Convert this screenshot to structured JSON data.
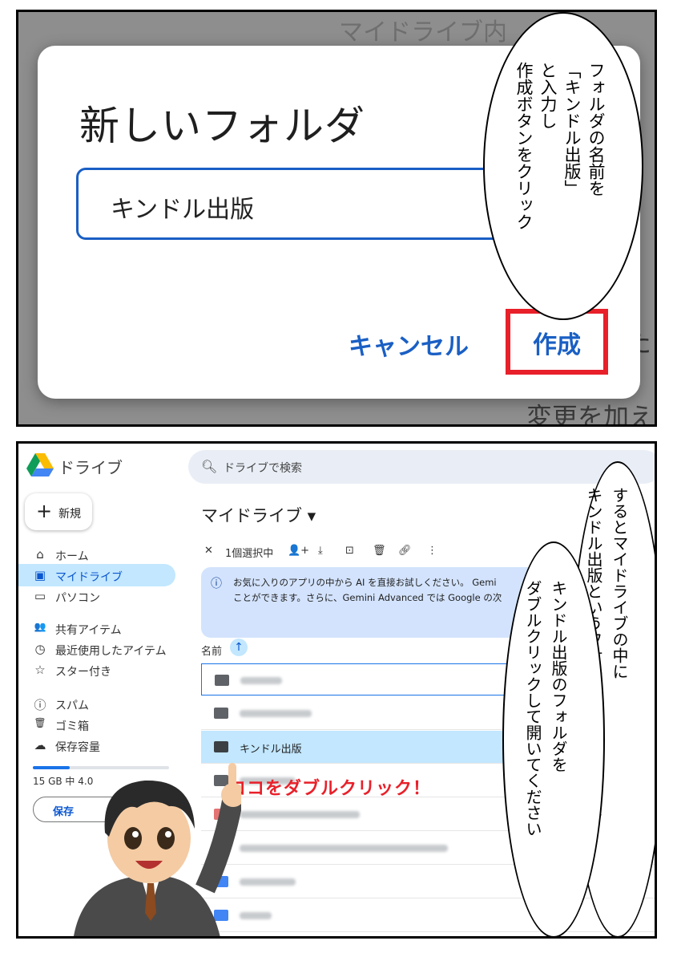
{
  "panel1": {
    "bg_text_top": "マイドライブ内",
    "bg_text_right": "た",
    "bg_text_bottom": "変更を加え",
    "dialog": {
      "title": "新しいフォルダ",
      "input_value": "キンドル出版",
      "cancel_label": "キャンセル",
      "create_label": "作成"
    },
    "bubble_lines": [
      "フォルダの名前を",
      "「キンドル出版」",
      "と入力し",
      "作成ボタンをクリック"
    ]
  },
  "panel2": {
    "app_name": "ドライブ",
    "search_placeholder": "ドライブで検索",
    "new_button": "新規",
    "sidebar": [
      {
        "icon": "home-icon",
        "glyph": "⌂",
        "label": "ホーム"
      },
      {
        "icon": "my-drive-icon",
        "glyph": "▣",
        "label": "マイドライブ",
        "active": true
      },
      {
        "icon": "computer-icon",
        "glyph": "▭",
        "label": "パソコン"
      },
      {
        "icon": "shared-icon",
        "glyph": "👥",
        "label": "共有アイテム"
      },
      {
        "icon": "recent-icon",
        "glyph": "◷",
        "label": "最近使用したアイテム"
      },
      {
        "icon": "star-icon",
        "glyph": "☆",
        "label": "スター付き"
      },
      {
        "icon": "spam-icon",
        "glyph": "ⓘ",
        "label": "スパム"
      },
      {
        "icon": "trash-icon",
        "glyph": "🗑",
        "label": "ゴミ箱"
      },
      {
        "icon": "cloud-icon",
        "glyph": "☁",
        "label": "保存容量"
      }
    ],
    "storage_text": "15 GB 中 4.0",
    "storage_fraction": 0.27,
    "storage_button": "保存",
    "page_title": "マイドライブ ▾",
    "selection_toolbar": {
      "close": "✕",
      "count": "1個選択中",
      "icons": [
        "share-user-icon",
        "download-icon",
        "move-icon",
        "trash-icon",
        "link-icon",
        "more-icon"
      ]
    },
    "banner_line1": "お気に入りのアプリの中から AI を直接お試しください。 Gemi",
    "banner_line2": "ことができます。さらに、Gemini Advanced では Google の次",
    "column_name": "名前",
    "selected_file": "キンドル出版",
    "callout": "ココをダブルクリック！",
    "bubble_right_lines": [
      "するとマイドライブの中に",
      "キンドル出版というフォルダが追加されるので"
    ],
    "bubble_left_lines": [
      "キンドル出版のフォルダを",
      "ダブルクリックして開いてください"
    ]
  },
  "colors": {
    "accent_blue": "#1a5fc4",
    "highlight_red": "#e8202a",
    "selection": "#c2e7ff"
  }
}
